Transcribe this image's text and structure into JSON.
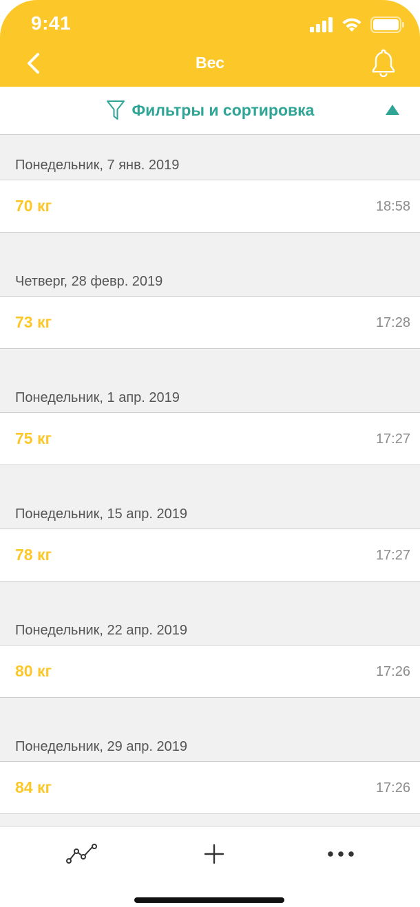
{
  "status_bar": {
    "time": "9:41"
  },
  "nav": {
    "title": "Вес"
  },
  "filter": {
    "label": "Фильтры и сортировка"
  },
  "entries": [
    {
      "date": "Понедельник, 7 янв. 2019",
      "weight": "70 кг",
      "time": "18:58"
    },
    {
      "date": "Четверг, 28 февр. 2019",
      "weight": "73 кг",
      "time": "17:28"
    },
    {
      "date": "Понедельник, 1 апр. 2019",
      "weight": "75 кг",
      "time": "17:27"
    },
    {
      "date": "Понедельник, 15 апр. 2019",
      "weight": "78 кг",
      "time": "17:27"
    },
    {
      "date": "Понедельник, 22 апр. 2019",
      "weight": "80 кг",
      "time": "17:26"
    },
    {
      "date": "Понедельник, 29 апр. 2019",
      "weight": "84 кг",
      "time": "17:26"
    }
  ],
  "tabbar": {
    "icons": [
      "chart-line-icon",
      "plus-icon",
      "more-icon"
    ]
  },
  "colors": {
    "header": "#FCC829",
    "accent_teal": "#2FA596",
    "weight_yellow": "#FCC829",
    "background_gray": "#F1F1F1"
  }
}
